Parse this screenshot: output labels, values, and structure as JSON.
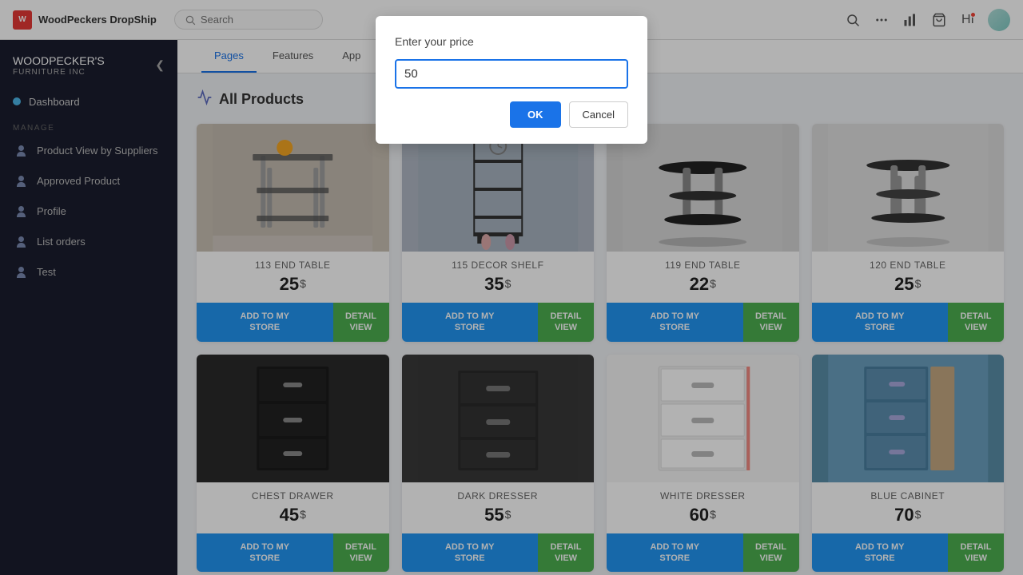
{
  "topbar": {
    "logo_icon": "W",
    "logo_text": "WoodPeckers DropShip",
    "search_placeholder": "Search"
  },
  "sidebar": {
    "brand_line1": "WOODPECKER'S",
    "brand_line2": "FURNITURE INC",
    "dashboard_label": "Dashboard",
    "manage_label": "MANAGE",
    "items": [
      {
        "id": "product-view-by-suppliers",
        "label": "Product View by Suppliers"
      },
      {
        "id": "approved-product",
        "label": "Approved Product"
      },
      {
        "id": "profile",
        "label": "Profile"
      },
      {
        "id": "list-orders",
        "label": "List orders"
      },
      {
        "id": "test",
        "label": "Test"
      }
    ]
  },
  "nav": {
    "tabs": [
      {
        "id": "pages",
        "label": "Pages"
      },
      {
        "id": "features",
        "label": "Features"
      },
      {
        "id": "app",
        "label": "App"
      }
    ]
  },
  "section": {
    "title": "All Products"
  },
  "modal": {
    "title": "Enter your price",
    "input_value": "50",
    "ok_label": "OK",
    "cancel_label": "Cancel"
  },
  "products": [
    {
      "id": "p1",
      "name": "113 END TABLE",
      "price": "25",
      "currency": "$",
      "add_label": "ADD TO MY\nSTORE",
      "detail_label": "DETAIL\nVIEW",
      "bg_class": "img-bg-1"
    },
    {
      "id": "p2",
      "name": "115 DECOR SHELF",
      "price": "35",
      "currency": "$",
      "add_label": "ADD TO MY\nSTORE",
      "detail_label": "DETAIL\nVIEW",
      "bg_class": "img-bg-2"
    },
    {
      "id": "p3",
      "name": "119 END TABLE",
      "price": "22",
      "currency": "$",
      "add_label": "ADD TO MY\nSTORE",
      "detail_label": "DETAIL\nVIEW",
      "bg_class": "img-bg-3"
    },
    {
      "id": "p4",
      "name": "120 END TABLE",
      "price": "25",
      "currency": "$",
      "add_label": "ADD TO MY\nSTORE",
      "detail_label": "DETAIL\nVIEW",
      "bg_class": "img-bg-4"
    },
    {
      "id": "p5",
      "name": "CHEST DRAWER",
      "price": "45",
      "currency": "$",
      "add_label": "ADD TO MY\nSTORE",
      "detail_label": "DETAIL\nVIEW",
      "bg_class": "img-bg-5"
    },
    {
      "id": "p6",
      "name": "DARK DRESSER",
      "price": "55",
      "currency": "$",
      "add_label": "ADD TO MY\nSTORE",
      "detail_label": "DETAIL\nVIEW",
      "bg_class": "img-bg-6"
    },
    {
      "id": "p7",
      "name": "WHITE DRESSER",
      "price": "60",
      "currency": "$",
      "add_label": "ADD TO MY\nSTORE",
      "detail_label": "DETAIL\nVIEW",
      "bg_class": "img-bg-7"
    },
    {
      "id": "p8",
      "name": "BLUE CABINET",
      "price": "70",
      "currency": "$",
      "add_label": "ADD TO MY\nSTORE",
      "detail_label": "DETAIL\nVIEW",
      "bg_class": "img-bg-8"
    }
  ]
}
